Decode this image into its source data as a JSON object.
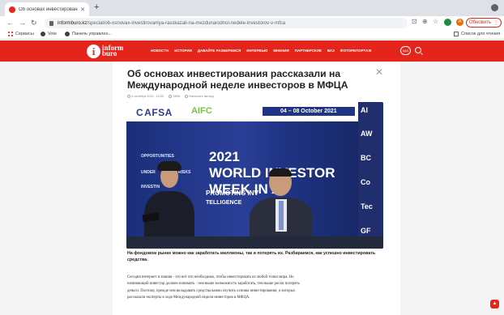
{
  "browser": {
    "tab_title": "Об основах инвестировани",
    "url_domain": "informburo.kz",
    "url_path": "/special/ob-osnovax-investirovaniya-rasskazali-na-mezdunarodnoi-nedele-investorov-v-mfca",
    "update_label": "Обновить",
    "profile_initial": "A"
  },
  "bookmarks": {
    "items": [
      {
        "label": "Сервисы",
        "icon": "apps-grid-icon"
      },
      {
        "label": "Vote",
        "icon": "globe-icon"
      },
      {
        "label": "Панель управлен...",
        "icon": "globe-icon"
      }
    ],
    "reading_list": "Список для чтения"
  },
  "site": {
    "logo_line1": "inform",
    "logo_line2": "buro",
    "menu": [
      "НОВОСТИ",
      "ИСТОРИИ",
      "ДАВАЙТЕ РАЗБЕРЕМСЯ",
      "ИНТЕРВЬЮ",
      "МНЕНИЯ",
      "ПАРТНЕРСКИЕ",
      "ВАЗ",
      "ФОТОРЕПОРТАЖ"
    ],
    "lang_button": "ҚАЗ",
    "brand_color": "#e5251b"
  },
  "article": {
    "title": "Об основах инвестирования рассказали на Международной неделе инвесторов в МФЦА",
    "date": "4 октября 2021, 14:05",
    "views": "2806",
    "write_author": "Написать автору",
    "caption": "На фондовом рынке можно как заработать миллионы, так и потерять их. Разбираемся, как успешно инвестировать средства.",
    "body": "Сегодня интернет и знания - это всё что необходимо, чтобы инвестировать из любой точки мира. Но начинающий инвестор должен понимать - чем выше возможность заработать, тем выше риски потерять деньги. Поэтому, прежде чем вкладывать средства важно изучить основы инвестирования, о которых рассказали эксперты в ходе Международной недели инвесторов в МФЦА."
  },
  "photo": {
    "logo_left": "AFSA",
    "logo_aifc": "AIFC",
    "date_banner": "04 – 08 October 2021",
    "headline_line1": "2021",
    "headline_line2": "WORLD INVESTOR",
    "headline_line3": "WEEK IN A",
    "left_labels": [
      "OPPORTUNITIES",
      "UNDER",
      "RISKS",
      "INVESTIN"
    ],
    "promo": "PROMOTING INV",
    "intel": "TELLIGENCE",
    "right_column": [
      "AI",
      "AW",
      "BC",
      "Co",
      "Tec",
      "GF"
    ]
  }
}
